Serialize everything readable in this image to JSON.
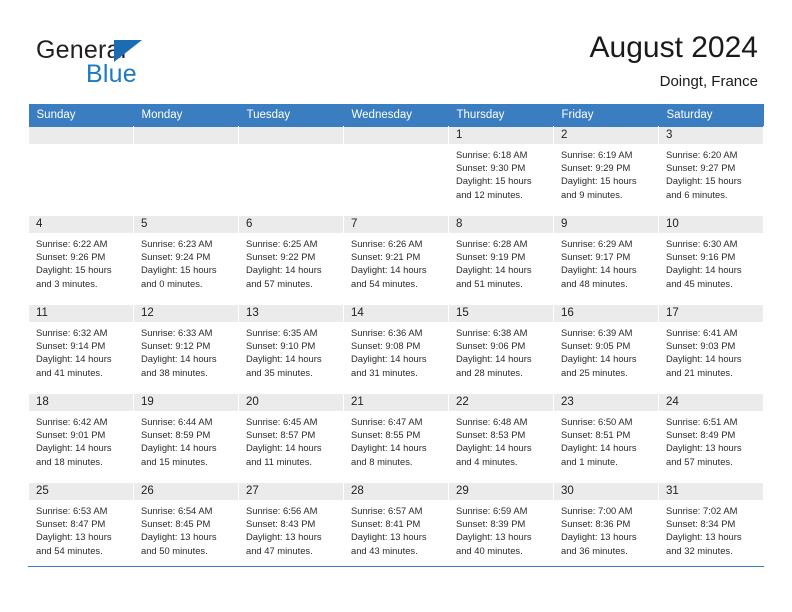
{
  "brand": {
    "name_part1": "General",
    "name_part2": "Blue",
    "accent_color": "#1b7ac4",
    "triangle_color": "#1b6cb3"
  },
  "header": {
    "title": "August 2024",
    "subtitle": "Doingt, France"
  },
  "theme": {
    "header_row_bg": "#3a7dc0",
    "daynum_bg": "#ebebeb",
    "grid_line": "#3a7dc0",
    "text": "#222222"
  },
  "weekday_headers": [
    "Sunday",
    "Monday",
    "Tuesday",
    "Wednesday",
    "Thursday",
    "Friday",
    "Saturday"
  ],
  "weeks": [
    [
      {
        "day": "",
        "sunrise": "",
        "sunset": "",
        "daylight_line1": "",
        "daylight_line2": "",
        "empty": true
      },
      {
        "day": "",
        "sunrise": "",
        "sunset": "",
        "daylight_line1": "",
        "daylight_line2": "",
        "empty": true
      },
      {
        "day": "",
        "sunrise": "",
        "sunset": "",
        "daylight_line1": "",
        "daylight_line2": "",
        "empty": true
      },
      {
        "day": "",
        "sunrise": "",
        "sunset": "",
        "daylight_line1": "",
        "daylight_line2": "",
        "empty": true
      },
      {
        "day": "1",
        "sunrise": "Sunrise: 6:18 AM",
        "sunset": "Sunset: 9:30 PM",
        "daylight_line1": "Daylight: 15 hours",
        "daylight_line2": "and 12 minutes.",
        "empty": false
      },
      {
        "day": "2",
        "sunrise": "Sunrise: 6:19 AM",
        "sunset": "Sunset: 9:29 PM",
        "daylight_line1": "Daylight: 15 hours",
        "daylight_line2": "and 9 minutes.",
        "empty": false
      },
      {
        "day": "3",
        "sunrise": "Sunrise: 6:20 AM",
        "sunset": "Sunset: 9:27 PM",
        "daylight_line1": "Daylight: 15 hours",
        "daylight_line2": "and 6 minutes.",
        "empty": false
      }
    ],
    [
      {
        "day": "4",
        "sunrise": "Sunrise: 6:22 AM",
        "sunset": "Sunset: 9:26 PM",
        "daylight_line1": "Daylight: 15 hours",
        "daylight_line2": "and 3 minutes.",
        "empty": false
      },
      {
        "day": "5",
        "sunrise": "Sunrise: 6:23 AM",
        "sunset": "Sunset: 9:24 PM",
        "daylight_line1": "Daylight: 15 hours",
        "daylight_line2": "and 0 minutes.",
        "empty": false
      },
      {
        "day": "6",
        "sunrise": "Sunrise: 6:25 AM",
        "sunset": "Sunset: 9:22 PM",
        "daylight_line1": "Daylight: 14 hours",
        "daylight_line2": "and 57 minutes.",
        "empty": false
      },
      {
        "day": "7",
        "sunrise": "Sunrise: 6:26 AM",
        "sunset": "Sunset: 9:21 PM",
        "daylight_line1": "Daylight: 14 hours",
        "daylight_line2": "and 54 minutes.",
        "empty": false
      },
      {
        "day": "8",
        "sunrise": "Sunrise: 6:28 AM",
        "sunset": "Sunset: 9:19 PM",
        "daylight_line1": "Daylight: 14 hours",
        "daylight_line2": "and 51 minutes.",
        "empty": false
      },
      {
        "day": "9",
        "sunrise": "Sunrise: 6:29 AM",
        "sunset": "Sunset: 9:17 PM",
        "daylight_line1": "Daylight: 14 hours",
        "daylight_line2": "and 48 minutes.",
        "empty": false
      },
      {
        "day": "10",
        "sunrise": "Sunrise: 6:30 AM",
        "sunset": "Sunset: 9:16 PM",
        "daylight_line1": "Daylight: 14 hours",
        "daylight_line2": "and 45 minutes.",
        "empty": false
      }
    ],
    [
      {
        "day": "11",
        "sunrise": "Sunrise: 6:32 AM",
        "sunset": "Sunset: 9:14 PM",
        "daylight_line1": "Daylight: 14 hours",
        "daylight_line2": "and 41 minutes.",
        "empty": false
      },
      {
        "day": "12",
        "sunrise": "Sunrise: 6:33 AM",
        "sunset": "Sunset: 9:12 PM",
        "daylight_line1": "Daylight: 14 hours",
        "daylight_line2": "and 38 minutes.",
        "empty": false
      },
      {
        "day": "13",
        "sunrise": "Sunrise: 6:35 AM",
        "sunset": "Sunset: 9:10 PM",
        "daylight_line1": "Daylight: 14 hours",
        "daylight_line2": "and 35 minutes.",
        "empty": false
      },
      {
        "day": "14",
        "sunrise": "Sunrise: 6:36 AM",
        "sunset": "Sunset: 9:08 PM",
        "daylight_line1": "Daylight: 14 hours",
        "daylight_line2": "and 31 minutes.",
        "empty": false
      },
      {
        "day": "15",
        "sunrise": "Sunrise: 6:38 AM",
        "sunset": "Sunset: 9:06 PM",
        "daylight_line1": "Daylight: 14 hours",
        "daylight_line2": "and 28 minutes.",
        "empty": false
      },
      {
        "day": "16",
        "sunrise": "Sunrise: 6:39 AM",
        "sunset": "Sunset: 9:05 PM",
        "daylight_line1": "Daylight: 14 hours",
        "daylight_line2": "and 25 minutes.",
        "empty": false
      },
      {
        "day": "17",
        "sunrise": "Sunrise: 6:41 AM",
        "sunset": "Sunset: 9:03 PM",
        "daylight_line1": "Daylight: 14 hours",
        "daylight_line2": "and 21 minutes.",
        "empty": false
      }
    ],
    [
      {
        "day": "18",
        "sunrise": "Sunrise: 6:42 AM",
        "sunset": "Sunset: 9:01 PM",
        "daylight_line1": "Daylight: 14 hours",
        "daylight_line2": "and 18 minutes.",
        "empty": false
      },
      {
        "day": "19",
        "sunrise": "Sunrise: 6:44 AM",
        "sunset": "Sunset: 8:59 PM",
        "daylight_line1": "Daylight: 14 hours",
        "daylight_line2": "and 15 minutes.",
        "empty": false
      },
      {
        "day": "20",
        "sunrise": "Sunrise: 6:45 AM",
        "sunset": "Sunset: 8:57 PM",
        "daylight_line1": "Daylight: 14 hours",
        "daylight_line2": "and 11 minutes.",
        "empty": false
      },
      {
        "day": "21",
        "sunrise": "Sunrise: 6:47 AM",
        "sunset": "Sunset: 8:55 PM",
        "daylight_line1": "Daylight: 14 hours",
        "daylight_line2": "and 8 minutes.",
        "empty": false
      },
      {
        "day": "22",
        "sunrise": "Sunrise: 6:48 AM",
        "sunset": "Sunset: 8:53 PM",
        "daylight_line1": "Daylight: 14 hours",
        "daylight_line2": "and 4 minutes.",
        "empty": false
      },
      {
        "day": "23",
        "sunrise": "Sunrise: 6:50 AM",
        "sunset": "Sunset: 8:51 PM",
        "daylight_line1": "Daylight: 14 hours",
        "daylight_line2": "and 1 minute.",
        "empty": false
      },
      {
        "day": "24",
        "sunrise": "Sunrise: 6:51 AM",
        "sunset": "Sunset: 8:49 PM",
        "daylight_line1": "Daylight: 13 hours",
        "daylight_line2": "and 57 minutes.",
        "empty": false
      }
    ],
    [
      {
        "day": "25",
        "sunrise": "Sunrise: 6:53 AM",
        "sunset": "Sunset: 8:47 PM",
        "daylight_line1": "Daylight: 13 hours",
        "daylight_line2": "and 54 minutes.",
        "empty": false
      },
      {
        "day": "26",
        "sunrise": "Sunrise: 6:54 AM",
        "sunset": "Sunset: 8:45 PM",
        "daylight_line1": "Daylight: 13 hours",
        "daylight_line2": "and 50 minutes.",
        "empty": false
      },
      {
        "day": "27",
        "sunrise": "Sunrise: 6:56 AM",
        "sunset": "Sunset: 8:43 PM",
        "daylight_line1": "Daylight: 13 hours",
        "daylight_line2": "and 47 minutes.",
        "empty": false
      },
      {
        "day": "28",
        "sunrise": "Sunrise: 6:57 AM",
        "sunset": "Sunset: 8:41 PM",
        "daylight_line1": "Daylight: 13 hours",
        "daylight_line2": "and 43 minutes.",
        "empty": false
      },
      {
        "day": "29",
        "sunrise": "Sunrise: 6:59 AM",
        "sunset": "Sunset: 8:39 PM",
        "daylight_line1": "Daylight: 13 hours",
        "daylight_line2": "and 40 minutes.",
        "empty": false
      },
      {
        "day": "30",
        "sunrise": "Sunrise: 7:00 AM",
        "sunset": "Sunset: 8:36 PM",
        "daylight_line1": "Daylight: 13 hours",
        "daylight_line2": "and 36 minutes.",
        "empty": false
      },
      {
        "day": "31",
        "sunrise": "Sunrise: 7:02 AM",
        "sunset": "Sunset: 8:34 PM",
        "daylight_line1": "Daylight: 13 hours",
        "daylight_line2": "and 32 minutes.",
        "empty": false
      }
    ]
  ]
}
